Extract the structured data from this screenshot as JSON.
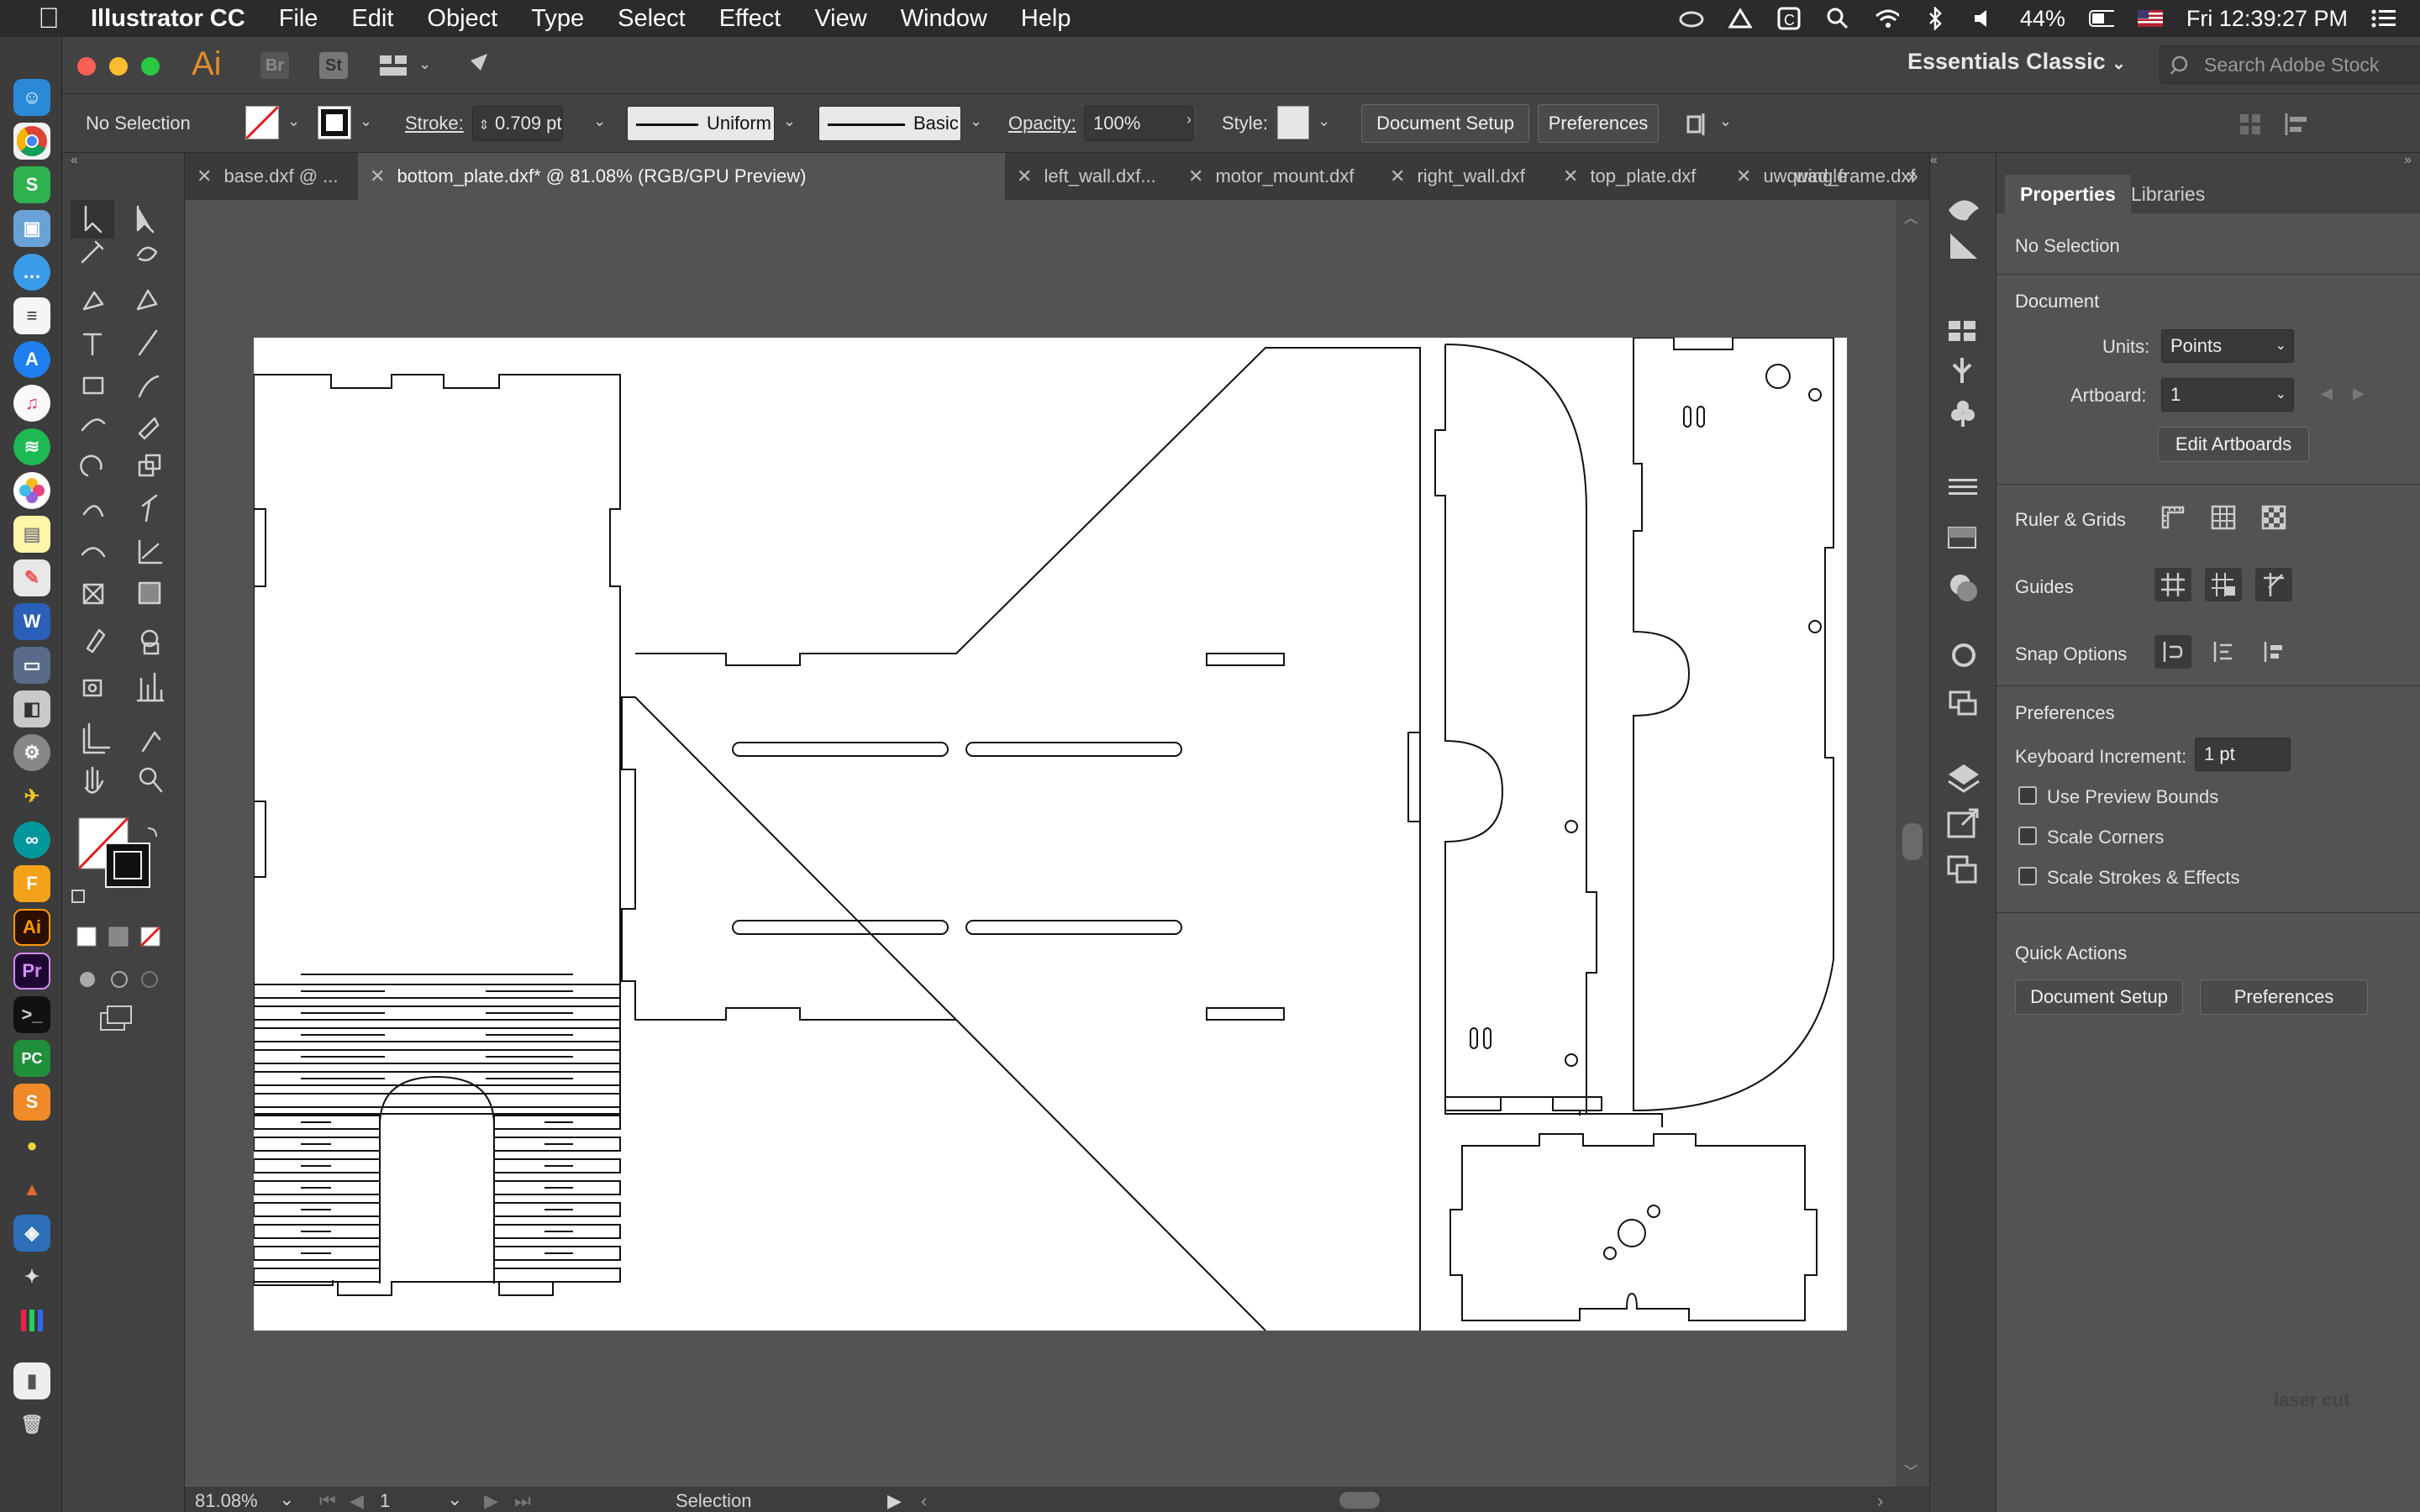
{
  "menubar": {
    "app_name": "Illustrator CC",
    "items": [
      "File",
      "Edit",
      "Object",
      "Type",
      "Select",
      "Effect",
      "View",
      "Window",
      "Help"
    ],
    "battery": "44%",
    "clock": "Fri 12:39:27 PM"
  },
  "appbar": {
    "logo": "Ai",
    "bridge": "Br",
    "stock": "St",
    "workspace": "Essentials Classic",
    "search_placeholder": "Search Adobe Stock"
  },
  "controlbar": {
    "selection": "No Selection",
    "stroke_label": "Stroke:",
    "stroke_value": "0.709 pt",
    "profile": "Uniform",
    "brush": "Basic",
    "opacity_label": "Opacity:",
    "opacity_value": "100%",
    "style_label": "Style:",
    "document_setup": "Document Setup",
    "preferences": "Preferences"
  },
  "tabs": [
    {
      "label": "base.dxf @ ...",
      "active": false
    },
    {
      "label": "bottom_plate.dxf* @ 81.08% (RGB/GPU Preview)",
      "active": true
    },
    {
      "label": "left_wall.dxf...",
      "active": false
    },
    {
      "label": "motor_mount.dxf",
      "active": false
    },
    {
      "label": "right_wall.dxf",
      "active": false
    },
    {
      "label": "top_plate.dxf",
      "active": false
    },
    {
      "label": "uwquad_frame.dxf",
      "active": false
    },
    {
      "label": "wingle",
      "active": false
    }
  ],
  "status": {
    "zoom": "81.08%",
    "artboard": "1",
    "tool": "Selection"
  },
  "properties": {
    "tab_properties": "Properties",
    "tab_libraries": "Libraries",
    "selection": "No Selection",
    "document_heading": "Document",
    "units_label": "Units:",
    "units_value": "Points",
    "artboard_label": "Artboard:",
    "artboard_value": "1",
    "edit_artboards": "Edit Artboards",
    "ruler_grids": "Ruler & Grids",
    "guides": "Guides",
    "snap_options": "Snap Options",
    "preferences_heading": "Preferences",
    "keyboard_increment_label": "Keyboard Increment:",
    "keyboard_increment_value": "1 pt",
    "use_preview_bounds": "Use Preview Bounds",
    "scale_corners": "Scale Corners",
    "scale_strokes": "Scale Strokes & Effects",
    "quick_actions": "Quick Actions",
    "document_setup": "Document Setup",
    "preferences": "Preferences",
    "watermark": "laser cut"
  }
}
